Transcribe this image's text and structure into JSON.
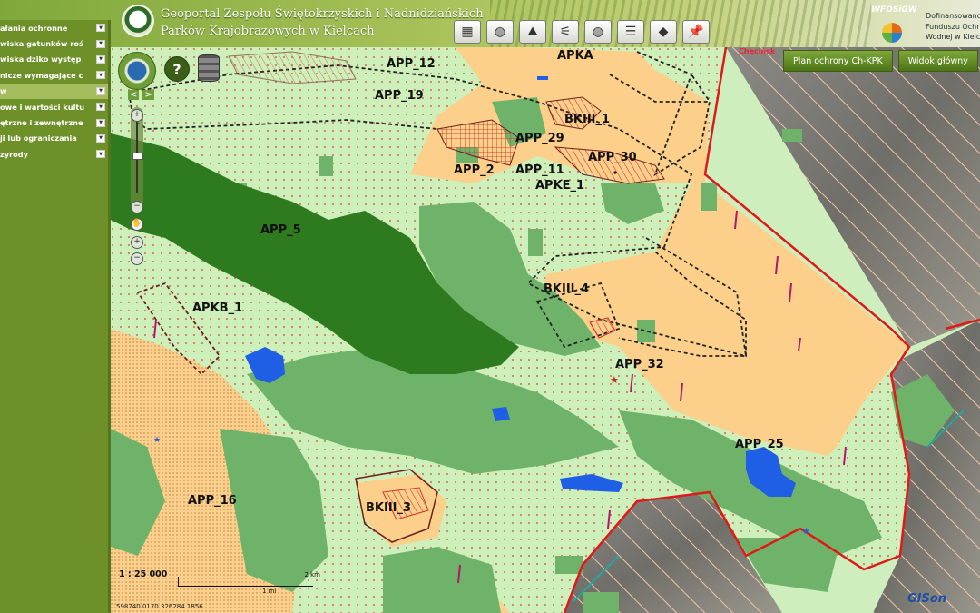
{
  "header": {
    "title_line1": "Geoportal Zespołu Świętokrzyskich i Nadnidziańskich",
    "title_line2": "Parków Krajobrazowych w Kielcach",
    "sponsor_logo_text": "WFOŚiGW",
    "sponsor_lines": [
      "Dofinansowano",
      "Funduszu Ochr",
      "Wodnej w Kielc"
    ]
  },
  "toolbar": {
    "icons": [
      "map-book-icon",
      "globe-network-icon",
      "mountain-profile-icon",
      "measure-tool-icon",
      "world-icon",
      "layers-icon",
      "diamond-shape-icon",
      "pin-icon"
    ],
    "glyphs": [
      "▦",
      "◍",
      "⛰",
      "⚟",
      "◍",
      "☰",
      "◆",
      "📌"
    ]
  },
  "sidebar": {
    "items": [
      {
        "label": "ałania ochronne",
        "active": false
      },
      {
        "label": "wiska gatunków roś",
        "active": false
      },
      {
        "label": "wiska dziko występ",
        "active": false
      },
      {
        "label": "nicze wymagające c",
        "active": false
      },
      {
        "label": "w",
        "active": true
      },
      {
        "label": "owe i wartości kultu",
        "active": false
      },
      {
        "label": "ętrzne i zewnętrzne",
        "active": false
      },
      {
        "label": "ji lub ograniczania",
        "active": false
      },
      {
        "label": "zyrody",
        "active": false
      }
    ]
  },
  "map_buttons": {
    "plan": "Plan ochrony Ch-KPK",
    "home": "Widok główny",
    "chek_label": "Chęcińsk"
  },
  "map_controls": {
    "help": "?",
    "left": "<",
    "right": ">",
    "plus": "+",
    "minus": "−",
    "hand": "✋"
  },
  "scale": {
    "ratio": "1 : 25 000",
    "km_label": "2 km",
    "mi_label": "1 mi"
  },
  "coords": "598740.0170 326284.1856",
  "branding": "GISon",
  "map_labels": [
    "APP_12",
    "APKA",
    "APP_19",
    "BKIII_1",
    "APP_29",
    "APP_30",
    "APP_2",
    "APP_11",
    "APKE_1",
    "APP_5",
    "APKB_1",
    "BKIII_4",
    "APP_32",
    "APP_25",
    "APP_16",
    "BKIII_3"
  ],
  "colors": {
    "reserve_orange": "#fcd08a",
    "forest_dark": "#2e7a1e",
    "forest_mid": "#6fb36a",
    "meadow_light": "#cdf0bb",
    "water": "#1f5fe6",
    "boundary_red": "#e01818"
  }
}
